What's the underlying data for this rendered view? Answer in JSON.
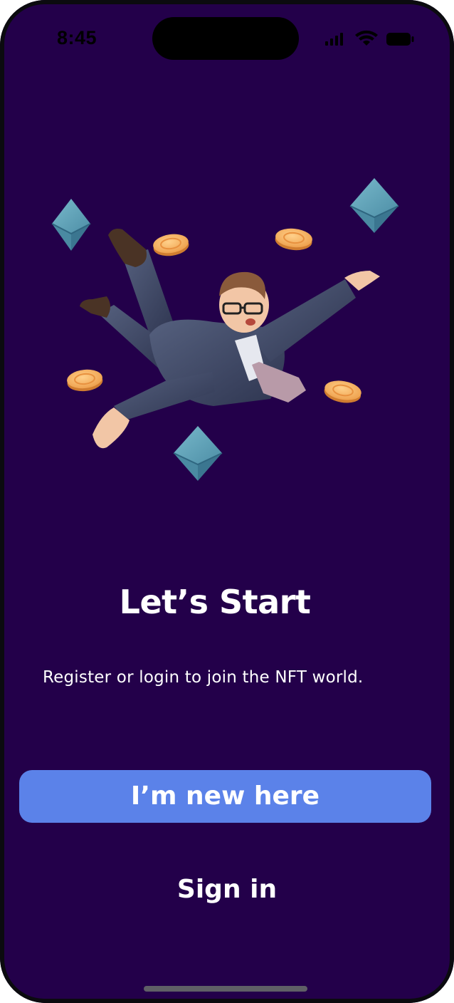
{
  "status_bar": {
    "time": "8:45",
    "icons": [
      "signal-icon",
      "wifi-icon",
      "battery-icon"
    ]
  },
  "hero": {
    "illustration": "falling-businessman-with-coins-and-ethereum",
    "decorations": [
      "ethereum-icon",
      "coin-icon"
    ]
  },
  "onboarding": {
    "title": "Let’s Start",
    "subtitle": "Register or login to join the NFT world."
  },
  "actions": {
    "primary_label": "I’m new here",
    "secondary_label": "Sign in"
  },
  "colors": {
    "background": "#23004a",
    "primary_button": "#5b82e9",
    "text": "#ffffff",
    "coin": "#f7a85a",
    "ethereum": "#5aa0b8"
  }
}
